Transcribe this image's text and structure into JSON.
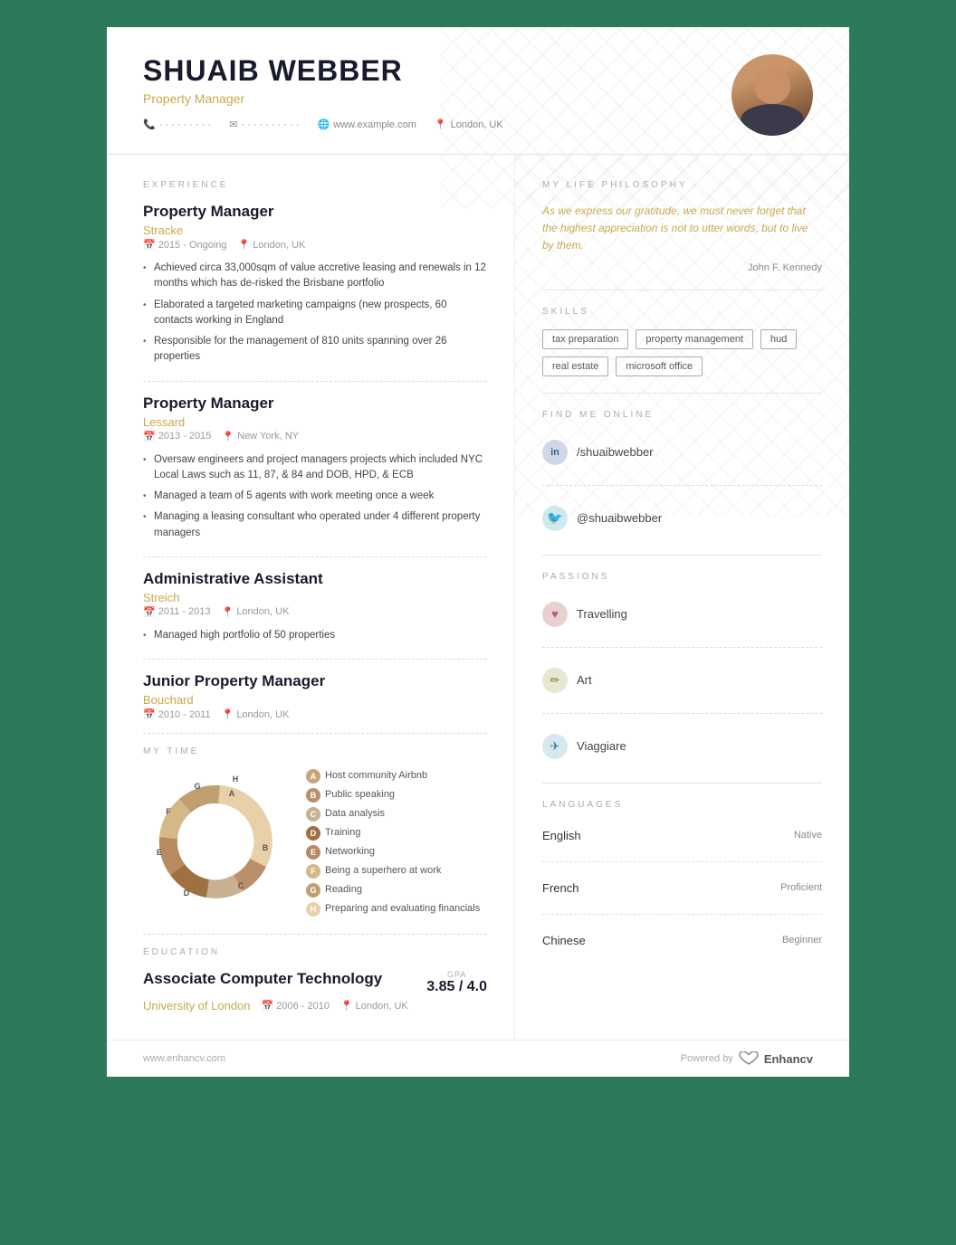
{
  "header": {
    "name": "SHUAIB WEBBER",
    "title": "Property Manager",
    "contact": {
      "phone": "· · · · · · · · ·",
      "email": "· · · · · · · · · ·",
      "website": "www.example.com",
      "location": "London, UK"
    }
  },
  "experience": {
    "section_title": "EXPERIENCE",
    "jobs": [
      {
        "title": "Property Manager",
        "company": "Stracke",
        "period": "2015 - Ongoing",
        "location": "London, UK",
        "bullets": [
          "Achieved circa 33,000sqm of value accretive leasing and renewals in 12 months which has de-risked the Brisbane portfolio",
          "Elaborated a targeted marketing campaigns (new prospects, 60 contacts working in England",
          "Responsible for the management of 810 units spanning over 26 properties"
        ]
      },
      {
        "title": "Property Manager",
        "company": "Lessard",
        "period": "2013 - 2015",
        "location": "New York, NY",
        "bullets": [
          "Oversaw engineers and project managers projects which included NYC Local Laws such as 11, 87, & 84 and DOB, HPD, & ECB",
          "Managed a team of 5 agents with work meeting once a week",
          "Managing a leasing consultant who operated under 4 different property managers"
        ]
      },
      {
        "title": "Administrative Assistant",
        "company": "Streich",
        "period": "2011 - 2013",
        "location": "London, UK",
        "bullets": [
          "Managed high portfolio of 50 properties"
        ]
      },
      {
        "title": "Junior Property Manager",
        "company": "Bouchard",
        "period": "2010 - 2011",
        "location": "London, UK",
        "bullets": []
      }
    ]
  },
  "my_time": {
    "section_title": "MY TIME",
    "items": [
      {
        "letter": "A",
        "label": "Host community Airbnb"
      },
      {
        "letter": "B",
        "label": "Public speaking"
      },
      {
        "letter": "C",
        "label": "Data analysis"
      },
      {
        "letter": "D",
        "label": "Training"
      },
      {
        "letter": "E",
        "label": "Networking"
      },
      {
        "letter": "F",
        "label": "Being a superhero at work"
      },
      {
        "letter": "G",
        "label": "Reading"
      },
      {
        "letter": "H",
        "label": "Preparing and evaluating financials"
      }
    ]
  },
  "education": {
    "section_title": "EDUCATION",
    "degree": "Associate Computer Technology",
    "school": "University of London",
    "period": "2006 - 2010",
    "location": "London, UK",
    "gpa_label": "GPA",
    "gpa_value": "3.85 / 4.0"
  },
  "philosophy": {
    "section_title": "MY LIFE PHILOSOPHY",
    "quote": "As we express our gratitude, we must never forget that the highest appreciation is not to utter words, but to live by them.",
    "author": "John F. Kennedy"
  },
  "skills": {
    "section_title": "SKILLS",
    "items": [
      "tax preparation",
      "property management",
      "hud",
      "real estate",
      "microsoft office"
    ]
  },
  "online": {
    "section_title": "FIND ME ONLINE",
    "items": [
      {
        "platform": "linkedin",
        "icon": "in",
        "handle": "/shuaibwebber"
      },
      {
        "platform": "twitter",
        "icon": "🐦",
        "handle": "@shuaibwebber"
      }
    ]
  },
  "passions": {
    "section_title": "PASSIONS",
    "items": [
      {
        "icon": "♥",
        "label": "Travelling"
      },
      {
        "icon": "✏",
        "label": "Art"
      },
      {
        "icon": "✈",
        "label": "Viaggiare"
      }
    ]
  },
  "languages": {
    "section_title": "LANGUAGES",
    "items": [
      {
        "name": "English",
        "level": "Native"
      },
      {
        "name": "French",
        "level": "Proficient"
      },
      {
        "name": "Chinese",
        "level": "Beginner"
      }
    ]
  },
  "footer": {
    "url": "www.enhancv.com",
    "powered_by": "Powered by",
    "brand": "Enhancv"
  }
}
